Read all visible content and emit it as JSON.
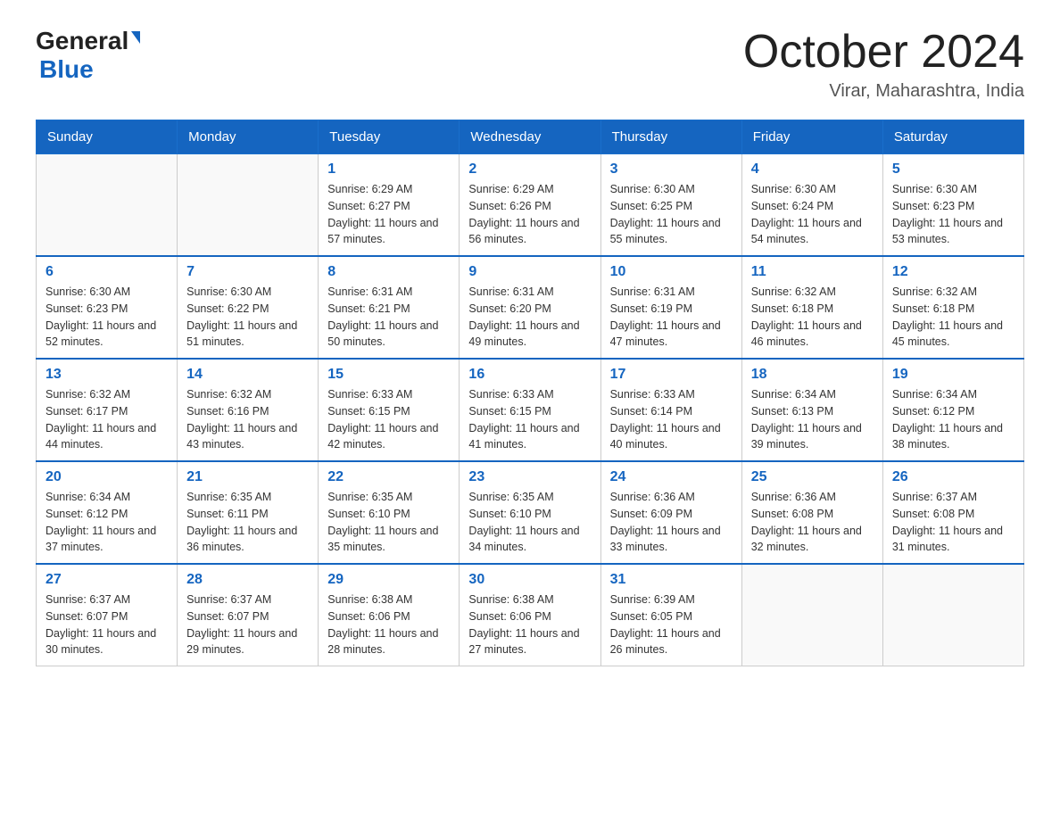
{
  "header": {
    "logo_general": "General",
    "logo_blue": "Blue",
    "month_title": "October 2024",
    "location": "Virar, Maharashtra, India"
  },
  "days_of_week": [
    "Sunday",
    "Monday",
    "Tuesday",
    "Wednesday",
    "Thursday",
    "Friday",
    "Saturday"
  ],
  "weeks": [
    [
      {
        "day": "",
        "sunrise": "",
        "sunset": "",
        "daylight": ""
      },
      {
        "day": "",
        "sunrise": "",
        "sunset": "",
        "daylight": ""
      },
      {
        "day": "1",
        "sunrise": "Sunrise: 6:29 AM",
        "sunset": "Sunset: 6:27 PM",
        "daylight": "Daylight: 11 hours and 57 minutes."
      },
      {
        "day": "2",
        "sunrise": "Sunrise: 6:29 AM",
        "sunset": "Sunset: 6:26 PM",
        "daylight": "Daylight: 11 hours and 56 minutes."
      },
      {
        "day": "3",
        "sunrise": "Sunrise: 6:30 AM",
        "sunset": "Sunset: 6:25 PM",
        "daylight": "Daylight: 11 hours and 55 minutes."
      },
      {
        "day": "4",
        "sunrise": "Sunrise: 6:30 AM",
        "sunset": "Sunset: 6:24 PM",
        "daylight": "Daylight: 11 hours and 54 minutes."
      },
      {
        "day": "5",
        "sunrise": "Sunrise: 6:30 AM",
        "sunset": "Sunset: 6:23 PM",
        "daylight": "Daylight: 11 hours and 53 minutes."
      }
    ],
    [
      {
        "day": "6",
        "sunrise": "Sunrise: 6:30 AM",
        "sunset": "Sunset: 6:23 PM",
        "daylight": "Daylight: 11 hours and 52 minutes."
      },
      {
        "day": "7",
        "sunrise": "Sunrise: 6:30 AM",
        "sunset": "Sunset: 6:22 PM",
        "daylight": "Daylight: 11 hours and 51 minutes."
      },
      {
        "day": "8",
        "sunrise": "Sunrise: 6:31 AM",
        "sunset": "Sunset: 6:21 PM",
        "daylight": "Daylight: 11 hours and 50 minutes."
      },
      {
        "day": "9",
        "sunrise": "Sunrise: 6:31 AM",
        "sunset": "Sunset: 6:20 PM",
        "daylight": "Daylight: 11 hours and 49 minutes."
      },
      {
        "day": "10",
        "sunrise": "Sunrise: 6:31 AM",
        "sunset": "Sunset: 6:19 PM",
        "daylight": "Daylight: 11 hours and 47 minutes."
      },
      {
        "day": "11",
        "sunrise": "Sunrise: 6:32 AM",
        "sunset": "Sunset: 6:18 PM",
        "daylight": "Daylight: 11 hours and 46 minutes."
      },
      {
        "day": "12",
        "sunrise": "Sunrise: 6:32 AM",
        "sunset": "Sunset: 6:18 PM",
        "daylight": "Daylight: 11 hours and 45 minutes."
      }
    ],
    [
      {
        "day": "13",
        "sunrise": "Sunrise: 6:32 AM",
        "sunset": "Sunset: 6:17 PM",
        "daylight": "Daylight: 11 hours and 44 minutes."
      },
      {
        "day": "14",
        "sunrise": "Sunrise: 6:32 AM",
        "sunset": "Sunset: 6:16 PM",
        "daylight": "Daylight: 11 hours and 43 minutes."
      },
      {
        "day": "15",
        "sunrise": "Sunrise: 6:33 AM",
        "sunset": "Sunset: 6:15 PM",
        "daylight": "Daylight: 11 hours and 42 minutes."
      },
      {
        "day": "16",
        "sunrise": "Sunrise: 6:33 AM",
        "sunset": "Sunset: 6:15 PM",
        "daylight": "Daylight: 11 hours and 41 minutes."
      },
      {
        "day": "17",
        "sunrise": "Sunrise: 6:33 AM",
        "sunset": "Sunset: 6:14 PM",
        "daylight": "Daylight: 11 hours and 40 minutes."
      },
      {
        "day": "18",
        "sunrise": "Sunrise: 6:34 AM",
        "sunset": "Sunset: 6:13 PM",
        "daylight": "Daylight: 11 hours and 39 minutes."
      },
      {
        "day": "19",
        "sunrise": "Sunrise: 6:34 AM",
        "sunset": "Sunset: 6:12 PM",
        "daylight": "Daylight: 11 hours and 38 minutes."
      }
    ],
    [
      {
        "day": "20",
        "sunrise": "Sunrise: 6:34 AM",
        "sunset": "Sunset: 6:12 PM",
        "daylight": "Daylight: 11 hours and 37 minutes."
      },
      {
        "day": "21",
        "sunrise": "Sunrise: 6:35 AM",
        "sunset": "Sunset: 6:11 PM",
        "daylight": "Daylight: 11 hours and 36 minutes."
      },
      {
        "day": "22",
        "sunrise": "Sunrise: 6:35 AM",
        "sunset": "Sunset: 6:10 PM",
        "daylight": "Daylight: 11 hours and 35 minutes."
      },
      {
        "day": "23",
        "sunrise": "Sunrise: 6:35 AM",
        "sunset": "Sunset: 6:10 PM",
        "daylight": "Daylight: 11 hours and 34 minutes."
      },
      {
        "day": "24",
        "sunrise": "Sunrise: 6:36 AM",
        "sunset": "Sunset: 6:09 PM",
        "daylight": "Daylight: 11 hours and 33 minutes."
      },
      {
        "day": "25",
        "sunrise": "Sunrise: 6:36 AM",
        "sunset": "Sunset: 6:08 PM",
        "daylight": "Daylight: 11 hours and 32 minutes."
      },
      {
        "day": "26",
        "sunrise": "Sunrise: 6:37 AM",
        "sunset": "Sunset: 6:08 PM",
        "daylight": "Daylight: 11 hours and 31 minutes."
      }
    ],
    [
      {
        "day": "27",
        "sunrise": "Sunrise: 6:37 AM",
        "sunset": "Sunset: 6:07 PM",
        "daylight": "Daylight: 11 hours and 30 minutes."
      },
      {
        "day": "28",
        "sunrise": "Sunrise: 6:37 AM",
        "sunset": "Sunset: 6:07 PM",
        "daylight": "Daylight: 11 hours and 29 minutes."
      },
      {
        "day": "29",
        "sunrise": "Sunrise: 6:38 AM",
        "sunset": "Sunset: 6:06 PM",
        "daylight": "Daylight: 11 hours and 28 minutes."
      },
      {
        "day": "30",
        "sunrise": "Sunrise: 6:38 AM",
        "sunset": "Sunset: 6:06 PM",
        "daylight": "Daylight: 11 hours and 27 minutes."
      },
      {
        "day": "31",
        "sunrise": "Sunrise: 6:39 AM",
        "sunset": "Sunset: 6:05 PM",
        "daylight": "Daylight: 11 hours and 26 minutes."
      },
      {
        "day": "",
        "sunrise": "",
        "sunset": "",
        "daylight": ""
      },
      {
        "day": "",
        "sunrise": "",
        "sunset": "",
        "daylight": ""
      }
    ]
  ]
}
